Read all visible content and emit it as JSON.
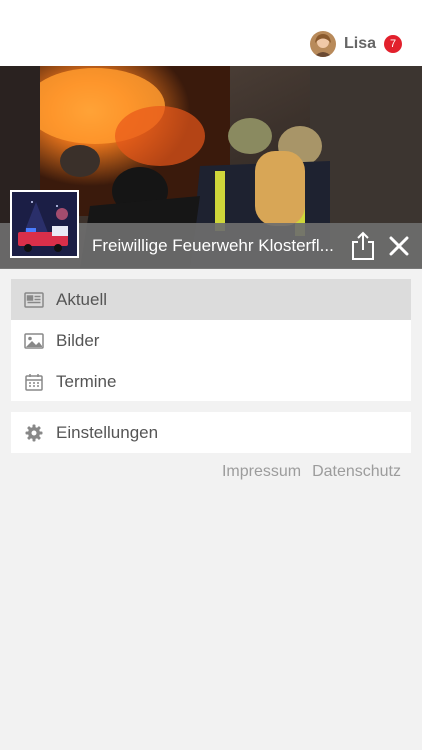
{
  "header": {
    "user_name": "Lisa",
    "notification_count": "7"
  },
  "group": {
    "title": "Freiwillige Feuerwehr Klosterfl..."
  },
  "menu": {
    "items": [
      {
        "label": "Aktuell",
        "icon": "newspaper-icon",
        "active": true
      },
      {
        "label": "Bilder",
        "icon": "image-icon",
        "active": false
      },
      {
        "label": "Termine",
        "icon": "calendar-icon",
        "active": false
      }
    ],
    "settings_label": "Einstellungen"
  },
  "footer": {
    "impressum": "Impressum",
    "datenschutz": "Datenschutz"
  },
  "colors": {
    "badge": "#e2202c",
    "active_item": "#dcdcdc",
    "titlebar": "#6e6e6e"
  }
}
